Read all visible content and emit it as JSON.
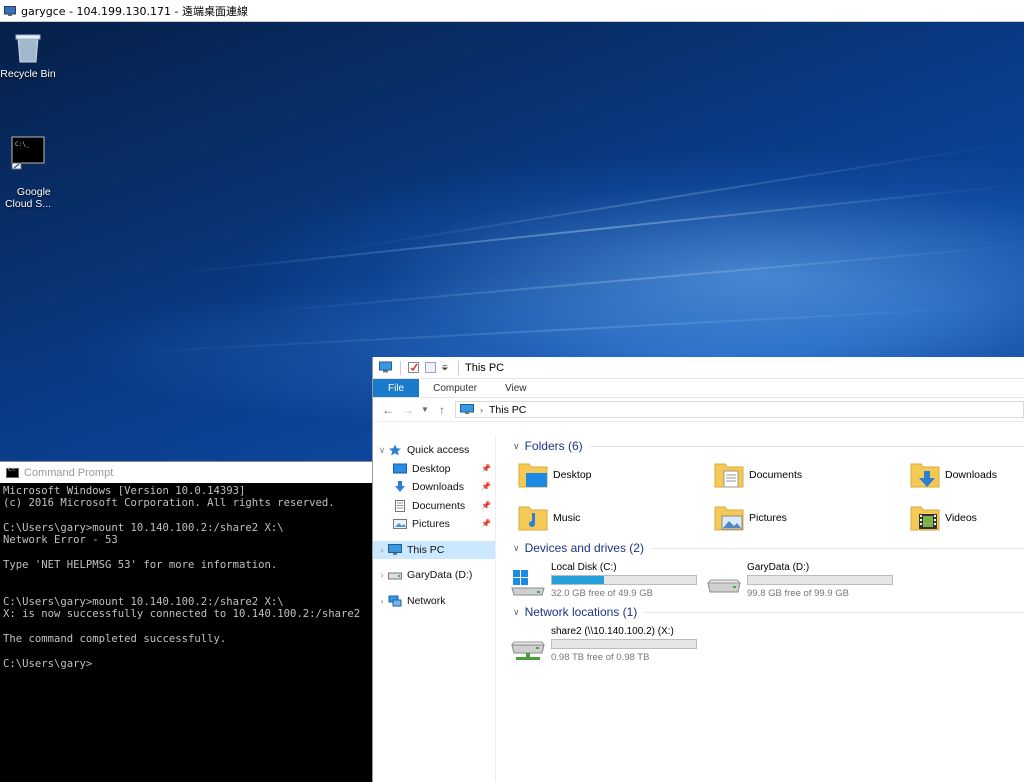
{
  "rdp": {
    "title": "garygce - 104.199.130.171 - 遠端桌面連線"
  },
  "desktop": {
    "icons": [
      {
        "label": "Recycle Bin",
        "icon": "recycle-bin-icon"
      },
      {
        "label": "Google\nCloud S...",
        "icon": "cmd-shortcut-icon"
      }
    ]
  },
  "cmd": {
    "title": "Command Prompt",
    "output": "Microsoft Windows [Version 10.0.14393]\n(c) 2016 Microsoft Corporation. All rights reserved.\n\nC:\\Users\\gary>mount 10.140.100.2:/share2 X:\\\nNetwork Error - 53\n\nType 'NET HELPMSG 53' for more information.\n\n\nC:\\Users\\gary>mount 10.140.100.2:/share2 X:\\\nX: is now successfully connected to 10.140.100.2:/share2\n\nThe command completed successfully.\n\nC:\\Users\\gary>"
  },
  "explorer": {
    "title": "This PC",
    "ribbon_tabs": [
      "File",
      "Computer",
      "View"
    ],
    "address": "This PC",
    "nav": {
      "quick_access": "Quick access",
      "quick_items": [
        "Desktop",
        "Downloads",
        "Documents",
        "Pictures"
      ],
      "this_pc": "This PC",
      "gary_data": "GaryData (D:)",
      "network": "Network"
    },
    "groups": {
      "folders": "Folders (6)",
      "devices": "Devices and drives (2)",
      "network": "Network locations (1)"
    },
    "folders": [
      "Desktop",
      "Documents",
      "Downloads",
      "Music",
      "Pictures",
      "Videos"
    ],
    "drives": [
      {
        "name": "Local Disk (C:)",
        "free": "32.0 GB free of 49.9 GB",
        "used_fraction": 0.36
      },
      {
        "name": "GaryData (D:)",
        "free": "99.8 GB free of 99.9 GB",
        "used_fraction": 0.0
      }
    ],
    "network_locations": [
      {
        "name": "share2 (\\\\10.140.100.2) (X:)",
        "free": "0.98 TB free of 0.98 TB",
        "used_fraction": 0.0
      }
    ]
  },
  "colors": {
    "accent": "#1979ca",
    "drive_fill": "#26a0da",
    "folder": "#f4c955"
  }
}
